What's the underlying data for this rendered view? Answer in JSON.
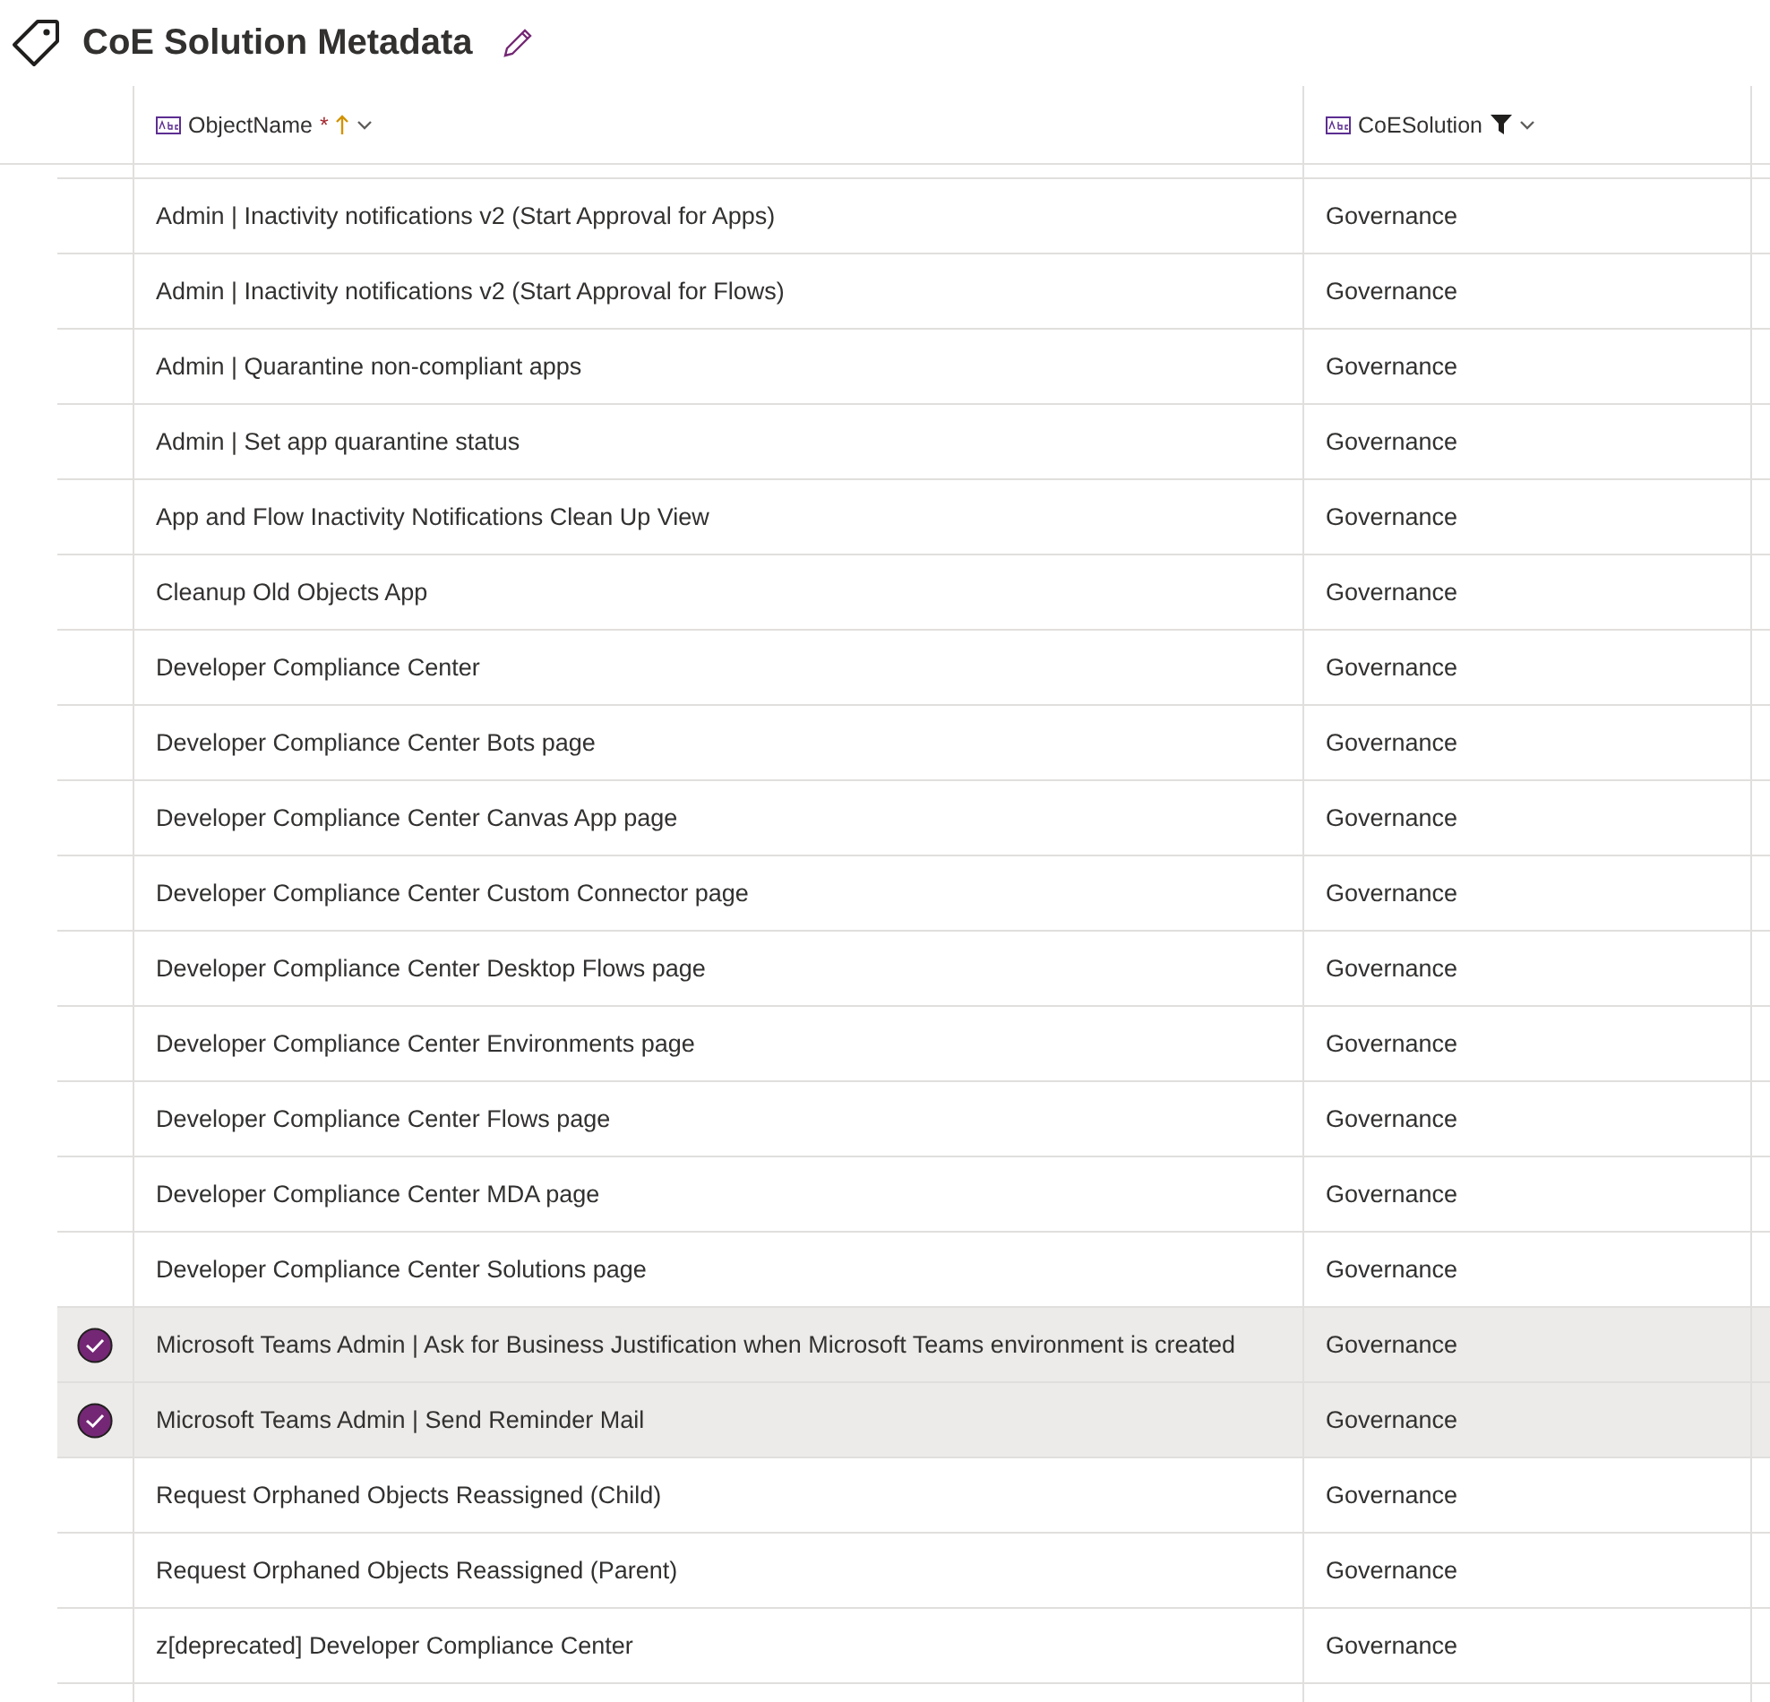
{
  "title": "CoE Solution Metadata",
  "columns": [
    {
      "label": "ObjectName",
      "required_mark": "*",
      "sorted": true,
      "filtered": false
    },
    {
      "label": "CoESolution",
      "sorted": false,
      "filtered": true
    }
  ],
  "rows": [
    {
      "name": "Admin | Inactivity notifications v2 (Start Approval for Apps)",
      "solution": "Governance",
      "selected": false
    },
    {
      "name": "Admin | Inactivity notifications v2 (Start Approval for Flows)",
      "solution": "Governance",
      "selected": false
    },
    {
      "name": "Admin | Quarantine non-compliant apps",
      "solution": "Governance",
      "selected": false
    },
    {
      "name": "Admin | Set app quarantine status",
      "solution": "Governance",
      "selected": false
    },
    {
      "name": "App and Flow Inactivity Notifications Clean Up View",
      "solution": "Governance",
      "selected": false
    },
    {
      "name": "Cleanup Old Objects App",
      "solution": "Governance",
      "selected": false
    },
    {
      "name": "Developer Compliance Center",
      "solution": "Governance",
      "selected": false
    },
    {
      "name": "Developer Compliance Center Bots page",
      "solution": "Governance",
      "selected": false
    },
    {
      "name": "Developer Compliance Center Canvas App page",
      "solution": "Governance",
      "selected": false
    },
    {
      "name": "Developer Compliance Center Custom Connector page",
      "solution": "Governance",
      "selected": false
    },
    {
      "name": "Developer Compliance Center Desktop Flows page",
      "solution": "Governance",
      "selected": false
    },
    {
      "name": "Developer Compliance Center Environments page",
      "solution": "Governance",
      "selected": false
    },
    {
      "name": "Developer Compliance Center Flows page",
      "solution": "Governance",
      "selected": false
    },
    {
      "name": "Developer Compliance Center MDA page",
      "solution": "Governance",
      "selected": false
    },
    {
      "name": "Developer Compliance Center Solutions page",
      "solution": "Governance",
      "selected": false
    },
    {
      "name": "Microsoft Teams Admin | Ask for Business Justification when Microsoft Teams environment is created",
      "solution": "Governance",
      "selected": true
    },
    {
      "name": "Microsoft Teams Admin | Send Reminder Mail",
      "solution": "Governance",
      "selected": true
    },
    {
      "name": "Request Orphaned Objects Reassigned (Child)",
      "solution": "Governance",
      "selected": false
    },
    {
      "name": "Request Orphaned Objects Reassigned (Parent)",
      "solution": "Governance",
      "selected": false
    },
    {
      "name": "z[deprecated] Developer Compliance Center",
      "solution": "Governance",
      "selected": false
    }
  ]
}
